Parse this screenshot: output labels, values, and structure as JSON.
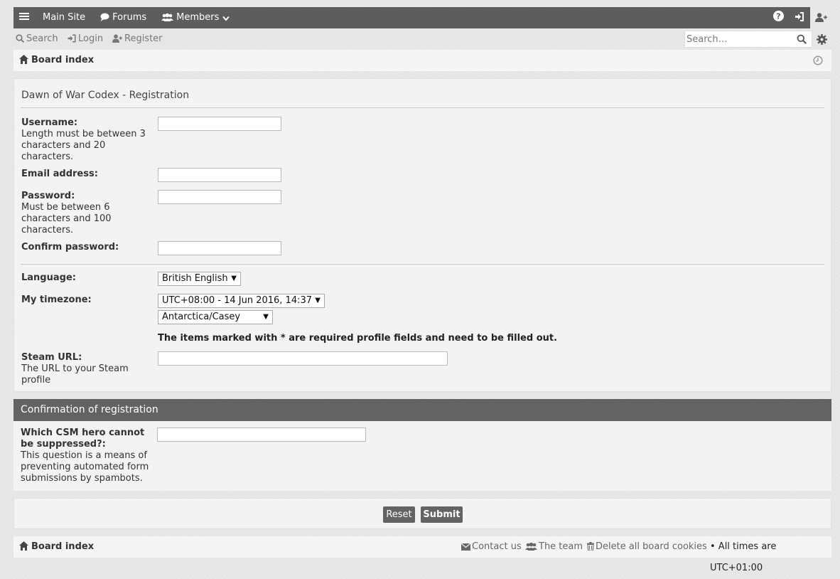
{
  "nav": {
    "main_site": "Main Site",
    "forums": "Forums",
    "members": "Members"
  },
  "subnav": {
    "search": "Search",
    "login": "Login",
    "register": "Register",
    "search_placeholder": "Search…"
  },
  "breadcrumb": {
    "board_index": "Board index"
  },
  "registration": {
    "title": "Dawn of War Codex - Registration",
    "username_label": "Username:",
    "username_help": "Length must be between 3 characters and 20 characters.",
    "email_label": "Email address:",
    "password_label": "Password:",
    "password_help": "Must be between 6 characters and 100 characters.",
    "confirm_label": "Confirm password:",
    "language_label": "Language:",
    "language_value": "British English",
    "timezone_label": "My timezone:",
    "timezone_value": "UTC+08:00 - 14 Jun 2016, 14:37",
    "timezone_region": "Antarctica/Casey",
    "required_note": "The items marked with * are required profile fields and need to be filled out.",
    "steam_label": "Steam URL:",
    "steam_help": "The URL to your Steam profile"
  },
  "confirmation": {
    "title": "Confirmation of registration",
    "question_label": "Which CSM hero cannot be suppressed?:",
    "question_help": "This question is a means of preventing automated form submissions by spambots."
  },
  "buttons": {
    "reset": "Reset",
    "submit": "Submit"
  },
  "footer": {
    "board_index": "Board index",
    "contact": "Contact us",
    "team": "The team",
    "delete_cookies": "Delete all board cookies",
    "times": "• All times are UTC+01:00"
  }
}
